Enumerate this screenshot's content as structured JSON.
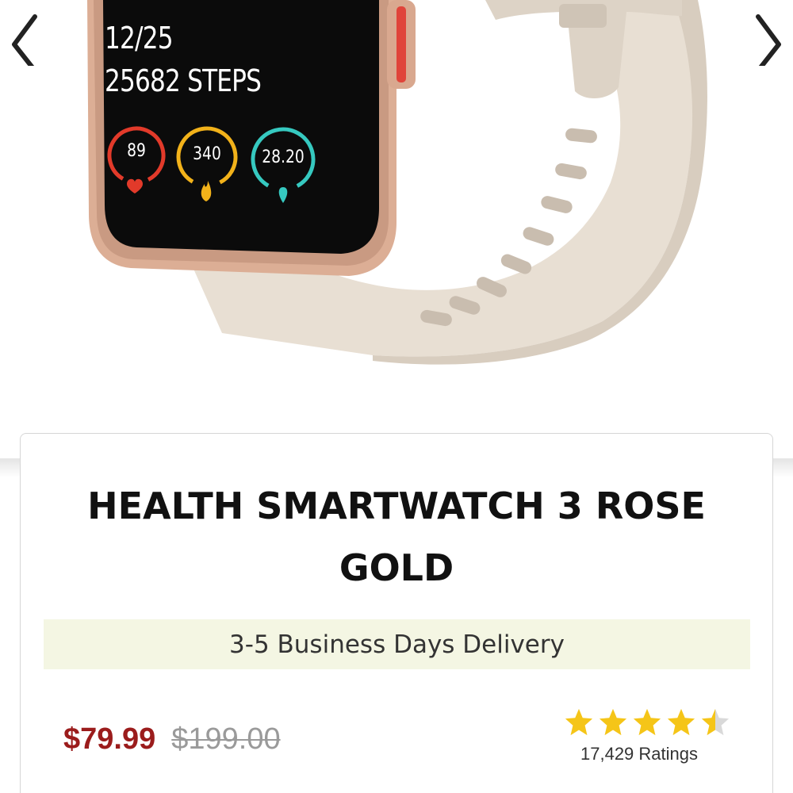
{
  "gallery": {
    "prev_icon": "chevron-left-icon",
    "next_icon": "chevron-right-icon",
    "watch_screen": {
      "date": "12/25",
      "steps": "25682 STEPS",
      "heart_rate": "89",
      "calories": "340",
      "distance": "28.20"
    },
    "colors": {
      "band": "#e6ddd1",
      "case": "#d9a98f",
      "button_accent": "#e0443a",
      "screen": "#0b0b0b"
    }
  },
  "product": {
    "title": "HEALTH SMARTWATCH 3 ROSE GOLD",
    "delivery": "3-5 Business Days Delivery",
    "price_current": "$79.99",
    "price_original": "$199.00",
    "rating_value": 4.5,
    "rating_max": 5,
    "ratings_count": "17,429 Ratings",
    "colors": {
      "price": "#9b1c1c",
      "star": "#f5c518",
      "delivery_bg": "#f4f6e3"
    }
  }
}
